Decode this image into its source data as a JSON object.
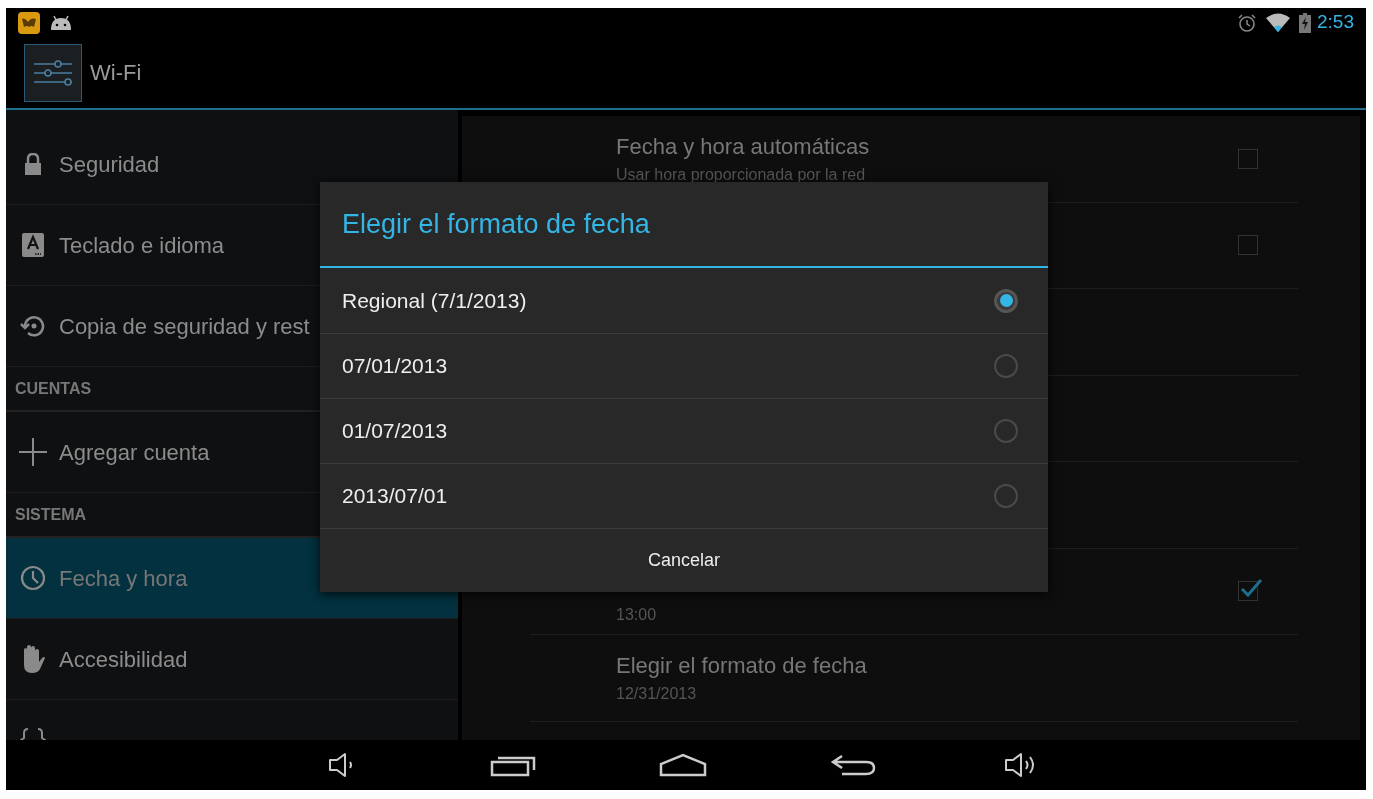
{
  "status_bar": {
    "time": "2:53"
  },
  "action_bar": {
    "title": "Wi-Fi"
  },
  "sidebar": {
    "items": [
      {
        "kind": "item",
        "label": "Seguridad",
        "selected": false
      },
      {
        "kind": "item",
        "label": "Teclado e idioma",
        "selected": false
      },
      {
        "kind": "item",
        "label": "Copia de seguridad y rest",
        "selected": false
      },
      {
        "kind": "header",
        "label": "CUENTAS"
      },
      {
        "kind": "item",
        "label": "Agregar cuenta",
        "selected": false
      },
      {
        "kind": "header",
        "label": "SISTEMA"
      },
      {
        "kind": "item",
        "label": "Fecha y hora",
        "selected": true
      },
      {
        "kind": "item",
        "label": "Accesibilidad",
        "selected": false
      },
      {
        "kind": "item",
        "selected": false
      }
    ]
  },
  "settings": {
    "rows": [
      {
        "kind": "checkbox",
        "title": "Fecha y hora automáticas",
        "subtitle": "Usar hora proporcionada por la red",
        "checked": false
      },
      {
        "kind": "checkbox",
        "checked": false
      },
      {
        "kind": "plain"
      },
      {
        "kind": "plain"
      },
      {
        "kind": "plain"
      },
      {
        "kind": "checkbox",
        "subtitle": "13:00",
        "checked": true
      },
      {
        "kind": "plain",
        "title": "Elegir el formato de fecha",
        "subtitle": "12/31/2013"
      }
    ]
  },
  "dialog": {
    "title": "Elegir el formato de fecha",
    "options": [
      {
        "label": "Regional (7/1/2013)",
        "selected": true
      },
      {
        "label": "07/01/2013",
        "selected": false
      },
      {
        "label": "01/07/2013",
        "selected": false
      },
      {
        "label": "2013/07/01",
        "selected": false
      }
    ],
    "buttons": [
      "Cancelar"
    ]
  }
}
